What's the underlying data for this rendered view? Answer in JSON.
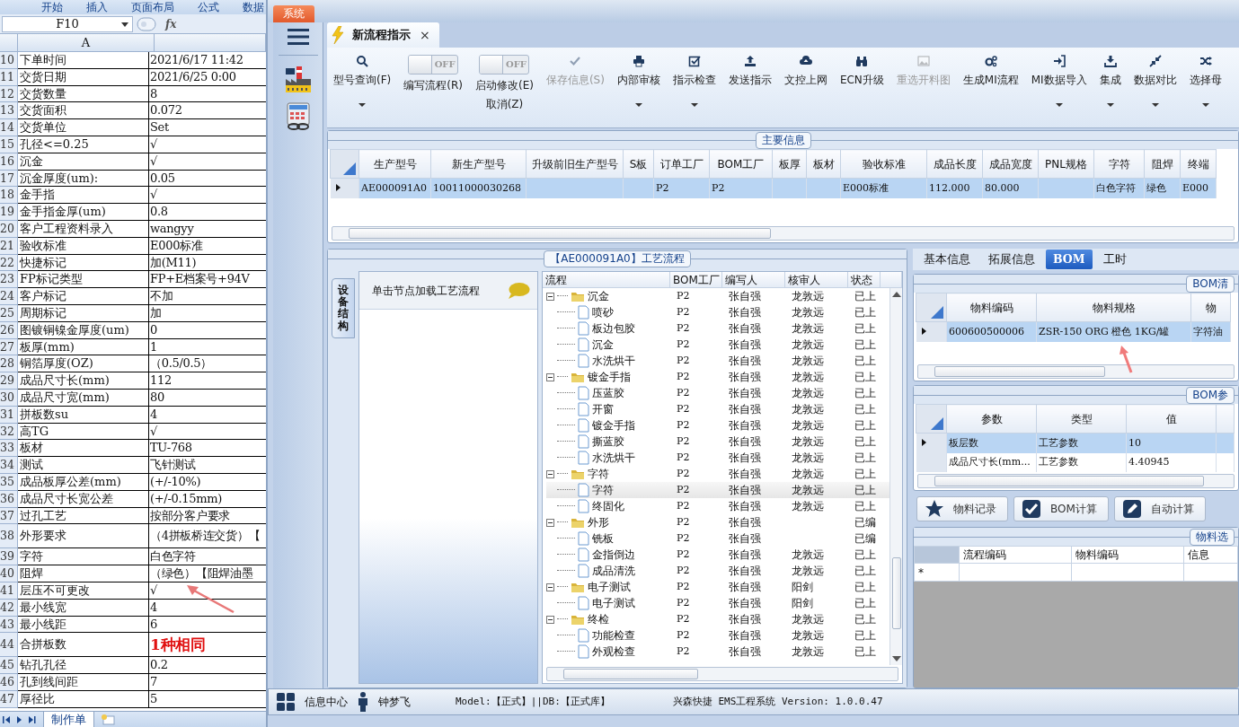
{
  "spreadsheet": {
    "ribbon_tabs": [
      "开始",
      "插入",
      "页面布局",
      "公式",
      "数据"
    ],
    "name_box": "F10",
    "formula_label": "fx",
    "column_header": "A",
    "rows": [
      {
        "num": "10",
        "label": "下单时间",
        "value": "2021/6/17 11:42",
        "kind": "plain"
      },
      {
        "num": "11",
        "label": "交货日期",
        "value": "2021/6/25 0:00",
        "kind": "plain"
      },
      {
        "num": "12",
        "label": "交货数量",
        "value": "8",
        "kind": "plain"
      },
      {
        "num": "13",
        "label": "交货面积",
        "value": "0.072",
        "kind": "plain"
      },
      {
        "num": "14",
        "label": "交货单位",
        "value": "Set",
        "kind": "plain"
      },
      {
        "num": "15",
        "label": "孔径<=0.25",
        "value": "√",
        "kind": "plain"
      },
      {
        "num": "16",
        "label": "沉金",
        "value": "√",
        "kind": "plain"
      },
      {
        "num": "17",
        "label": "沉金厚度(um):",
        "value": "0.05",
        "kind": "plain"
      },
      {
        "num": "18",
        "label": "金手指",
        "value": "√",
        "kind": "plain"
      },
      {
        "num": "19",
        "label": "金手指金厚(um)",
        "value": "0.8",
        "kind": "plain"
      },
      {
        "num": "20",
        "label": "客户工程资料录入",
        "value": "wangyy",
        "kind": "plain"
      },
      {
        "num": "21",
        "label": "验收标准",
        "value": "E000标准",
        "kind": "plain"
      },
      {
        "num": "22",
        "label": "快捷标记",
        "value": "加(M11)",
        "kind": "plain"
      },
      {
        "num": "23",
        "label": "FP标记类型",
        "value": "FP+E档案号+94V",
        "kind": "plain"
      },
      {
        "num": "24",
        "label": "客户标记",
        "value": "不加",
        "kind": "plain"
      },
      {
        "num": "25",
        "label": "周期标记",
        "value": "加",
        "kind": "plain"
      },
      {
        "num": "26",
        "label": "图镀铜镍金厚度(um)",
        "value": "0",
        "kind": "plain"
      },
      {
        "num": "27",
        "label": "板厚(mm)",
        "value": "1",
        "kind": "plain"
      },
      {
        "num": "28",
        "label": "铜箔厚度(OZ)",
        "value": "（0.5/0.5）",
        "kind": "plain"
      },
      {
        "num": "29",
        "label": "成品尺寸长(mm)",
        "value": "112",
        "kind": "plain"
      },
      {
        "num": "30",
        "label": "成品尺寸宽(mm)",
        "value": "80",
        "kind": "plain"
      },
      {
        "num": "31",
        "label": "拼板数su",
        "value": "4",
        "kind": "plain"
      },
      {
        "num": "32",
        "label": "高TG",
        "value": "√",
        "kind": "plain"
      },
      {
        "num": "33",
        "label": "板材",
        "value": "TU-768",
        "kind": "plain"
      },
      {
        "num": "34",
        "label": "测试",
        "value": "飞针测试",
        "kind": "plain"
      },
      {
        "num": "35",
        "label": "成品板厚公差(mm)",
        "value": "(+/-10%)",
        "kind": "plain"
      },
      {
        "num": "36",
        "label": "成品尺寸长宽公差",
        "value": "(+/-0.15mm)",
        "kind": "plain"
      },
      {
        "num": "37",
        "label": "过孔工艺",
        "value": "按部分客户要求",
        "kind": "plain"
      },
      {
        "num": "38",
        "label": "外形要求",
        "value": "（4拼板桥连交货）【",
        "kind": "tall"
      },
      {
        "num": "39",
        "label": "字符",
        "value": "白色字符",
        "kind": "plain"
      },
      {
        "num": "40",
        "label": "阻焊",
        "value": "（绿色）【阻焊油墨",
        "kind": "plain"
      },
      {
        "num": "41",
        "label": "层压不可更改",
        "value": "√",
        "kind": "plain"
      },
      {
        "num": "42",
        "label": "最小线宽",
        "value": "4",
        "kind": "plain"
      },
      {
        "num": "43",
        "label": "最小线距",
        "value": "6",
        "kind": "plain"
      },
      {
        "num": "44",
        "label": "合拼板数",
        "value": "1种相同",
        "kind": "emphasis"
      },
      {
        "num": "45",
        "label": "钻孔孔径",
        "value": "0.2",
        "kind": "plain"
      },
      {
        "num": "46",
        "label": "孔到线间距",
        "value": "7",
        "kind": "plain"
      },
      {
        "num": "47",
        "label": "厚径比",
        "value": "5",
        "kind": "plain"
      }
    ],
    "sheet_tabs": [
      {
        "label": "制作单",
        "selected": true
      }
    ]
  },
  "app": {
    "system_tab": "系统",
    "doc_tab": {
      "title": "新流程指示",
      "close": "×",
      "selected": true
    },
    "toolbar": [
      {
        "kind": "button",
        "label": "型号查询(F)",
        "disabled": false,
        "dropdown": true
      },
      {
        "kind": "toggle",
        "label": "编写流程(R)",
        "state_text": "OFF",
        "on": false
      },
      {
        "kind": "toggle",
        "label": "启动修改(E)",
        "sublabel": "取消(Z)",
        "state_text": "OFF",
        "on": false
      },
      {
        "kind": "button",
        "label": "保存信息(S)",
        "disabled": true,
        "dropdown": false
      },
      {
        "kind": "button",
        "label": "内部审核",
        "disabled": false,
        "dropdown": true
      },
      {
        "kind": "button",
        "label": "指示检查",
        "disabled": false,
        "dropdown": true
      },
      {
        "kind": "button",
        "label": "发送指示",
        "disabled": false,
        "dropdown": false
      },
      {
        "kind": "button",
        "label": "文控上网",
        "disabled": false,
        "dropdown": false
      },
      {
        "kind": "button",
        "label": "ECN升级",
        "disabled": false,
        "dropdown": false
      },
      {
        "kind": "button",
        "label": "重选开料图",
        "disabled": true,
        "dropdown": false
      },
      {
        "kind": "button",
        "label": "生成MI流程",
        "disabled": false,
        "dropdown": false
      },
      {
        "kind": "button",
        "label": "MI数据导入",
        "disabled": false,
        "dropdown": true
      },
      {
        "kind": "button",
        "label": "集成",
        "disabled": false,
        "dropdown": true
      },
      {
        "kind": "button",
        "label": "数据对比",
        "disabled": false,
        "dropdown": true
      },
      {
        "kind": "button",
        "label": "选择母",
        "disabled": false,
        "dropdown": true
      }
    ],
    "main_info": {
      "title": "主要信息",
      "columns": [
        "生产型号",
        "新生产型号",
        "升级前旧生产型号",
        "S板",
        "订单工厂",
        "BOM工厂",
        "板厚",
        "板材",
        "验收标准",
        "成品长度",
        "成品宽度",
        "PNL规格",
        "字符",
        "阻焊",
        "终端"
      ],
      "rows": [
        {
          "selected": true,
          "cells": [
            "AE000091A0",
            "10011000030268",
            "",
            "",
            "P2",
            "P2",
            "",
            "",
            "E000标准",
            "112.000",
            "80.000",
            "",
            "白色字符",
            "绿色",
            "E000"
          ]
        }
      ]
    },
    "flow": {
      "title": "【AE000091A0】工艺流程",
      "side_tab": "设备结构",
      "hint": "单击节点加载工艺流程",
      "columns": [
        "流程",
        "BOM工厂",
        "编写人",
        "核审人",
        "状态"
      ],
      "tree": [
        {
          "name": "沉金",
          "factory": "P2",
          "writer": "张自强",
          "reviewer": "龙敦远",
          "status": "已上",
          "expanded": true,
          "selected": false,
          "children": [
            {
              "name": "喷砂",
              "factory": "P2",
              "writer": "张自强",
              "reviewer": "龙敦远",
              "status": "已上",
              "selected": false
            },
            {
              "name": "板边包胶",
              "factory": "P2",
              "writer": "张自强",
              "reviewer": "龙敦远",
              "status": "已上",
              "selected": false
            },
            {
              "name": "沉金",
              "factory": "P2",
              "writer": "张自强",
              "reviewer": "龙敦远",
              "status": "已上",
              "selected": false
            },
            {
              "name": "水洗烘干",
              "factory": "P2",
              "writer": "张自强",
              "reviewer": "龙敦远",
              "status": "已上",
              "selected": false
            }
          ]
        },
        {
          "name": "镀金手指",
          "factory": "P2",
          "writer": "张自强",
          "reviewer": "龙敦远",
          "status": "已上",
          "expanded": true,
          "selected": false,
          "children": [
            {
              "name": "压蓝胶",
              "factory": "P2",
              "writer": "张自强",
              "reviewer": "龙敦远",
              "status": "已上",
              "selected": false
            },
            {
              "name": "开窗",
              "factory": "P2",
              "writer": "张自强",
              "reviewer": "龙敦远",
              "status": "已上",
              "selected": false
            },
            {
              "name": "镀金手指",
              "factory": "P2",
              "writer": "张自强",
              "reviewer": "龙敦远",
              "status": "已上",
              "selected": false
            },
            {
              "name": "撕蓝胶",
              "factory": "P2",
              "writer": "张自强",
              "reviewer": "龙敦远",
              "status": "已上",
              "selected": false
            },
            {
              "name": "水洗烘干",
              "factory": "P2",
              "writer": "张自强",
              "reviewer": "龙敦远",
              "status": "已上",
              "selected": false
            }
          ]
        },
        {
          "name": "字符",
          "factory": "P2",
          "writer": "张自强",
          "reviewer": "龙敦远",
          "status": "已上",
          "expanded": true,
          "selected": false,
          "children": [
            {
              "name": "字符",
              "factory": "P2",
              "writer": "张自强",
              "reviewer": "龙敦远",
              "status": "已上",
              "selected": true
            },
            {
              "name": "终固化",
              "factory": "P2",
              "writer": "张自强",
              "reviewer": "龙敦远",
              "status": "已上",
              "selected": false
            }
          ]
        },
        {
          "name": "外形",
          "factory": "P2",
          "writer": "张自强",
          "status": "已编",
          "expanded": true,
          "selected": false,
          "children": [
            {
              "name": "铣板",
              "factory": "P2",
              "writer": "张自强",
              "status": "已编",
              "selected": false
            },
            {
              "name": "金指倒边",
              "factory": "P2",
              "writer": "张自强",
              "reviewer": "龙敦远",
              "status": "已上",
              "selected": false
            },
            {
              "name": "成品清洗",
              "factory": "P2",
              "writer": "张自强",
              "reviewer": "龙敦远",
              "status": "已上",
              "selected": false
            }
          ]
        },
        {
          "name": "电子测试",
          "factory": "P2",
          "writer": "张自强",
          "reviewer": "阳剑",
          "status": "已上",
          "expanded": true,
          "selected": false,
          "children": [
            {
              "name": "电子测试",
              "factory": "P2",
              "writer": "张自强",
              "reviewer": "阳剑",
              "status": "已上",
              "selected": false
            }
          ]
        },
        {
          "name": "终检",
          "factory": "P2",
          "writer": "张自强",
          "reviewer": "龙敦远",
          "status": "已上",
          "expanded": true,
          "selected": false,
          "children": [
            {
              "name": "功能检查",
              "factory": "P2",
              "writer": "张自强",
              "reviewer": "龙敦远",
              "status": "已上",
              "selected": false
            },
            {
              "name": "外观检查",
              "factory": "P2",
              "writer": "张自强",
              "reviewer": "龙敦远",
              "status": "已上",
              "selected": false
            }
          ]
        }
      ]
    },
    "detail_tabs": [
      {
        "label": "基本信息",
        "selected": false
      },
      {
        "label": "拓展信息",
        "selected": false
      },
      {
        "label": "BOM",
        "selected": true
      },
      {
        "label": "工时",
        "selected": false
      }
    ],
    "bom_list": {
      "title": "BOM清",
      "columns": [
        "物料编码",
        "物料规格",
        "物"
      ],
      "rows": [
        {
          "selected": true,
          "cells": [
            "600600500006",
            "ZSR-150 ORG 橙色 1KG/罐",
            "字符油"
          ]
        }
      ]
    },
    "bom_params": {
      "title": "BOM参",
      "columns": [
        "参数",
        "类型",
        "值",
        ""
      ],
      "rows": [
        {
          "selected": true,
          "cells": [
            "板层数",
            "工艺参数",
            "10",
            ""
          ]
        },
        {
          "selected": false,
          "cells": [
            "成品尺寸长(mm...",
            "工艺参数",
            "4.40945",
            ""
          ]
        }
      ]
    },
    "action_buttons": [
      "物料记录",
      "BOM计算",
      "自动计算"
    ],
    "material_select": {
      "title": "物料选",
      "columns": [
        "流程编码",
        "物料编码",
        "信息"
      ],
      "new_row_marker": "*"
    },
    "status_bar": {
      "info_center": "信息中心",
      "user": "钟梦飞",
      "model": "Model:【正式】||DB:【正式库】",
      "version": "兴森快捷  EMS工程系统  Version: 1.0.0.47"
    }
  }
}
